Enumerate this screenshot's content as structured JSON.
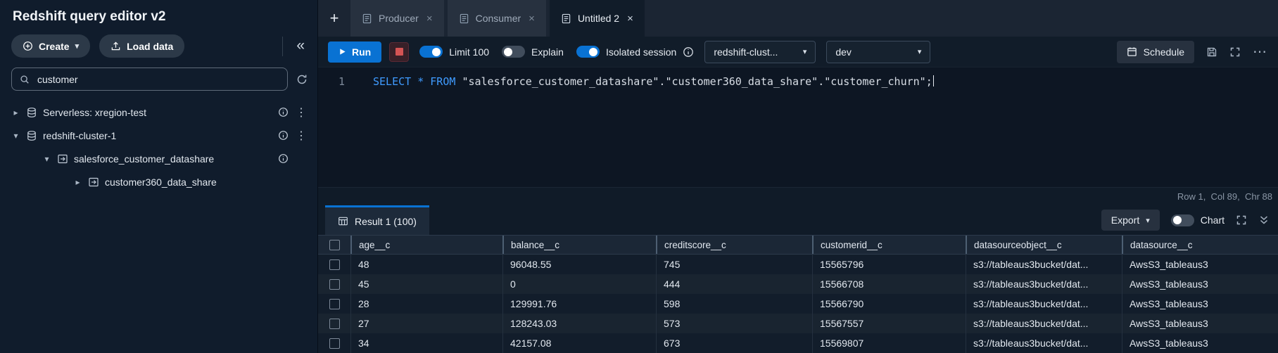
{
  "app": {
    "title": "Redshift query editor v2"
  },
  "colors": {
    "accent": "#0972d3",
    "keyword": "#3f9bff",
    "stop": "#d45454"
  },
  "icons": {
    "plus": "+",
    "caret_down": "▾",
    "chevron_right": "▸",
    "chevron_down": "▾",
    "kebab": "⋮",
    "collapse": "«",
    "close": "×",
    "ellipsis": "⋯"
  },
  "sidebar": {
    "create_label": "Create",
    "load_data_label": "Load data",
    "search_value": "customer",
    "tree": [
      {
        "label": "Serverless: xregion-test",
        "level": 0,
        "expanded": false,
        "icon": "cluster",
        "info": true,
        "menu": true
      },
      {
        "label": "redshift-cluster-1",
        "level": 0,
        "expanded": true,
        "icon": "cluster",
        "info": true,
        "menu": true
      },
      {
        "label": "salesforce_customer_datashare",
        "level": 1,
        "expanded": true,
        "icon": "datashare",
        "info": true,
        "menu": false
      },
      {
        "label": "customer360_data_share",
        "level": 2,
        "expanded": false,
        "icon": "datashare",
        "info": false,
        "menu": false
      }
    ]
  },
  "tabs": [
    {
      "label": "Producer",
      "active": false
    },
    {
      "label": "Consumer",
      "active": false
    },
    {
      "label": "Untitled 2",
      "active": true
    }
  ],
  "toolbar": {
    "run_label": "Run",
    "toggles": [
      {
        "label": "Limit 100",
        "on": true,
        "info": false
      },
      {
        "label": "Explain",
        "on": false,
        "info": false
      },
      {
        "label": "Isolated session",
        "on": true,
        "info": true
      }
    ],
    "cluster_value": "redshift-clust...",
    "database_value": "dev",
    "schedule_label": "Schedule"
  },
  "editor": {
    "line_number": "1",
    "sql_tokens": [
      {
        "text": "SELECT",
        "type": "keyword"
      },
      {
        "text": " ",
        "type": "plain"
      },
      {
        "text": "*",
        "type": "keyword"
      },
      {
        "text": " ",
        "type": "plain"
      },
      {
        "text": "FROM",
        "type": "keyword"
      },
      {
        "text": " ",
        "type": "plain"
      },
      {
        "text": "\"salesforce_customer_datashare\"",
        "type": "identifier"
      },
      {
        "text": ".",
        "type": "plain"
      },
      {
        "text": "\"customer360_data_share\"",
        "type": "identifier"
      },
      {
        "text": ".",
        "type": "plain"
      },
      {
        "text": "\"customer_churn\"",
        "type": "identifier"
      },
      {
        "text": ";",
        "type": "plain"
      }
    ],
    "status": "Row 1,  Col 89,  Chr 88"
  },
  "results": {
    "tab_label": "Result 1 (100)",
    "export_label": "Export",
    "chart_label": "Chart",
    "chart_on": false,
    "table": {
      "columns": [
        "age__c",
        "balance__c",
        "creditscore__c",
        "customerid__c",
        "datasourceobject__c",
        "datasource__c"
      ],
      "rows": [
        [
          "48",
          "96048.55",
          "745",
          "15565796",
          "s3://tableaus3bucket/dat...",
          "AwsS3_tableaus3"
        ],
        [
          "45",
          "0",
          "444",
          "15566708",
          "s3://tableaus3bucket/dat...",
          "AwsS3_tableaus3"
        ],
        [
          "28",
          "129991.76",
          "598",
          "15566790",
          "s3://tableaus3bucket/dat...",
          "AwsS3_tableaus3"
        ],
        [
          "27",
          "128243.03",
          "573",
          "15567557",
          "s3://tableaus3bucket/dat...",
          "AwsS3_tableaus3"
        ],
        [
          "34",
          "42157.08",
          "673",
          "15569807",
          "s3://tableaus3bucket/dat...",
          "AwsS3_tableaus3"
        ]
      ]
    }
  }
}
